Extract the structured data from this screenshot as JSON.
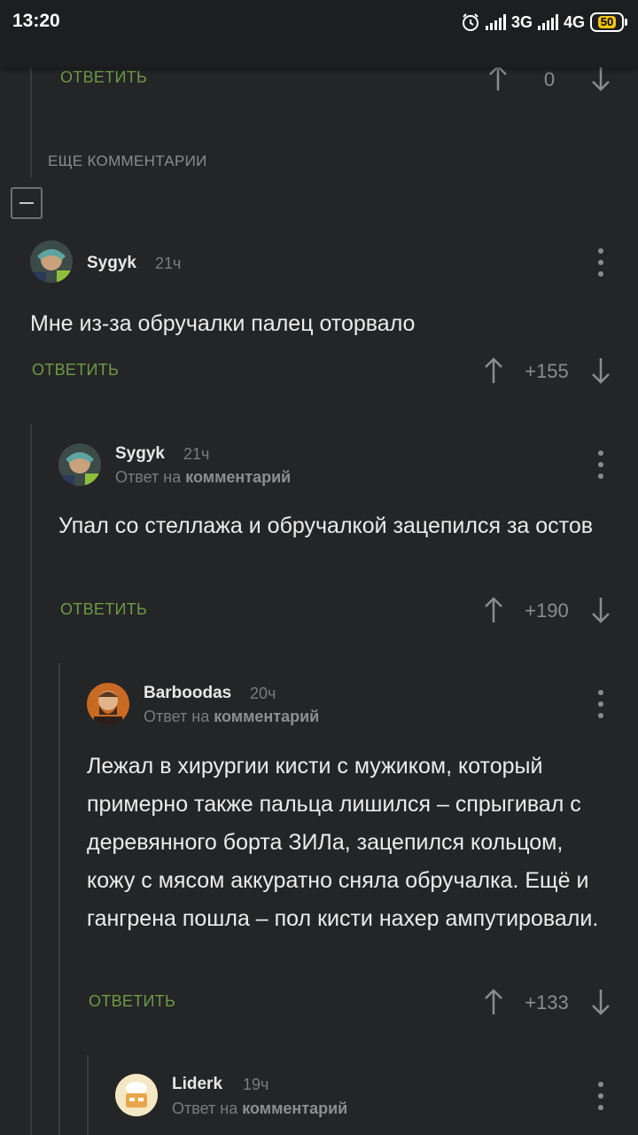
{
  "status": {
    "time": "13:20",
    "net1": "3G",
    "net2": "4G",
    "battery": "50"
  },
  "top": {
    "reply_label": "ОТВЕТИТЬ",
    "score": "0",
    "more_label": "ЕЩЕ КОММЕНТАРИИ"
  },
  "comments": [
    {
      "author": "Sygyk",
      "time": "21ч",
      "text": "Мне из-за обручалки палец оторвало",
      "reply_label": "ОТВЕТИТЬ",
      "score": "+155"
    },
    {
      "author": "Sygyk",
      "time": "21ч",
      "reply_prefix": "Ответ на",
      "reply_target": "комментарий",
      "text": "Упал со стеллажа и обручалкой зацепился за остов",
      "reply_label": "ОТВЕТИТЬ",
      "score": "+190"
    },
    {
      "author": "Barboodas",
      "time": "20ч",
      "reply_prefix": "Ответ на",
      "reply_target": "комментарий",
      "text": "Лежал в хирургии кисти с мужиком, который примерно также пальца лишился – спрыгивал с деревянного борта ЗИЛа, зацепился кольцом, кожу с мясом аккуратно сняла обручалка. Ещё и гангрена пошла – пол кисти нахер ампутировали.",
      "reply_label": "ОТВЕТИТЬ",
      "score": "+133"
    },
    {
      "author": "Liderk",
      "time": "19ч",
      "reply_prefix": "Ответ на",
      "reply_target": "комментарий"
    }
  ]
}
